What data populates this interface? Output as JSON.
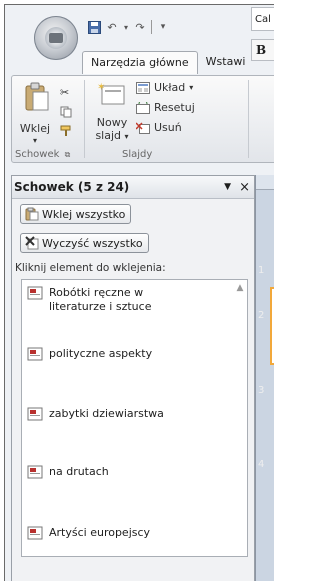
{
  "ribbon": {
    "tabs": [
      {
        "label": "Narzędzia główne"
      },
      {
        "label": "Wstawi"
      }
    ],
    "clipboard_group": {
      "paste_label": "Wklej",
      "group_label": "Schowek"
    },
    "slides_group": {
      "new_slide_label_line1": "Nowy",
      "new_slide_label_line2": "slajd",
      "layout_label": "Układ",
      "reset_label": "Resetuj",
      "delete_label": "Usuń",
      "group_label": "Slajdy"
    },
    "font_box_value": "Cal",
    "bold_label": "B"
  },
  "pane": {
    "title": "Schowek (5 z 24)",
    "paste_all_label": "Wklej wszystko",
    "clear_all_label": "Wyczyść wszystko",
    "hint": "Kliknij element do wklejenia:",
    "items": [
      {
        "line1": "Robótki ręczne w",
        "line2": "literaturze i sztuce"
      },
      {
        "line1": "polityczne aspekty",
        "line2": ""
      },
      {
        "line1": "zabytki dziewiarstwa",
        "line2": ""
      },
      {
        "line1": "na drutach",
        "line2": ""
      },
      {
        "line1": "Artyści europejscy",
        "line2": ""
      }
    ]
  },
  "slides": {
    "numbers": [
      "1",
      "2",
      "3",
      "4"
    ]
  }
}
